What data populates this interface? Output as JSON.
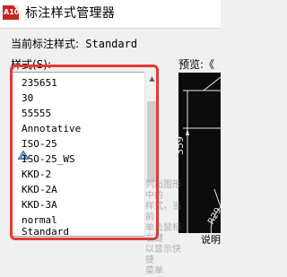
{
  "window": {
    "title": "标注样式管理器",
    "icon": "autocad-app-icon",
    "icon_text": "A10"
  },
  "current_style": {
    "label": "当前标注样式:",
    "value": "Standard"
  },
  "styles": {
    "label": "样式(S):",
    "items": [
      {
        "label": "235651",
        "annotative": false
      },
      {
        "label": "30",
        "annotative": false
      },
      {
        "label": "55555",
        "annotative": false
      },
      {
        "label": "Annotative",
        "annotative": true
      },
      {
        "label": "ISO-25",
        "annotative": false
      },
      {
        "label": "ISO-25_WS",
        "annotative": false
      },
      {
        "label": "KKD-2",
        "annotative": false
      },
      {
        "label": "KKD-2A",
        "annotative": false
      },
      {
        "label": "KKD-3A",
        "annotative": false
      },
      {
        "label": "normal",
        "annotative": false
      },
      {
        "label": "Standard",
        "annotative": false
      }
    ]
  },
  "preview": {
    "label": "预览:《",
    "dimension_value": "359",
    "dimension_value_2": "R29",
    "bottom_text": "说明"
  },
  "watermark": {
    "lines": [
      "列出图形中的",
      "样式，当前",
      "单击鼠标右键",
      "以显示快捷",
      "菜单"
    ]
  },
  "colors": {
    "highlight": "#e53935",
    "preview_bg": "#0c0c0c",
    "preview_lines": "#e8e8e8",
    "accent": "#c8251f"
  }
}
